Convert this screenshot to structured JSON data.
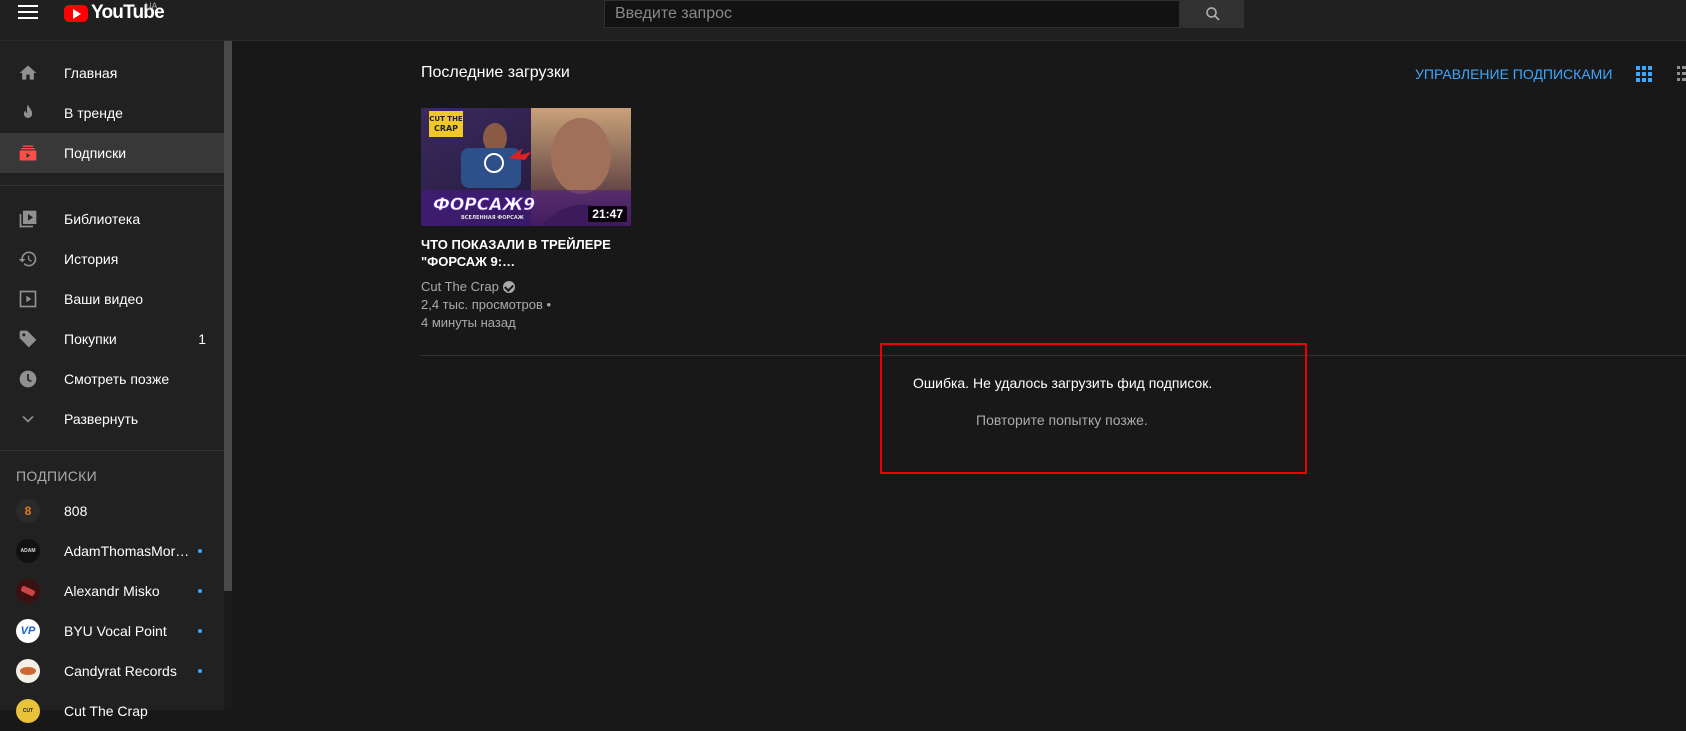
{
  "header": {
    "logo_text": "YouTube",
    "logo_region": "UA",
    "search_placeholder": "Введите запрос"
  },
  "sidebar": {
    "main_items": [
      {
        "label": "Главная",
        "icon": "home-icon"
      },
      {
        "label": "В тренде",
        "icon": "fire-icon"
      },
      {
        "label": "Подписки",
        "icon": "subscriptions-icon",
        "active": true
      }
    ],
    "library_items": [
      {
        "label": "Библиотека",
        "icon": "library-icon"
      },
      {
        "label": "История",
        "icon": "history-icon"
      },
      {
        "label": "Ваши видео",
        "icon": "your-videos-icon"
      },
      {
        "label": "Покупки",
        "icon": "tag-icon",
        "count": "1"
      },
      {
        "label": "Смотреть позже",
        "icon": "clock-icon"
      },
      {
        "label": "Развернуть",
        "icon": "chevron-down-icon"
      }
    ],
    "subscriptions_header": "ПОДПИСКИ",
    "subscriptions": [
      {
        "name": "808",
        "new": false
      },
      {
        "name": "AdamThomasMor…",
        "new": true
      },
      {
        "name": "Alexandr Misko",
        "new": true
      },
      {
        "name": "BYU Vocal Point",
        "new": true
      },
      {
        "name": "Candyrat Records",
        "new": true
      },
      {
        "name": "Cut The Crap",
        "new": false
      }
    ]
  },
  "main": {
    "section_title": "Последние загрузки",
    "manage_label": "УПРАВЛЕНИЕ ПОДПИСКАМИ",
    "video": {
      "thumbnail_text": "ФОРСАЖ9",
      "thumbnail_subtext": "ВСЕЛЕННАЯ ФОРСАЖ",
      "thumbnail_badge": "CUT THE CRAP",
      "duration": "21:47",
      "title": "ЧТО ПОКАЗАЛИ В ТРЕЙЛЕРЕ \"ФОРСАЖ 9:…",
      "channel": "Cut The Crap",
      "views": "2,4 тыс. просмотров •",
      "age": "4 минуты назад"
    },
    "error_message": "Ошибка. Не удалось загрузить фид подписок.",
    "retry_message": "Повторите попытку позже."
  },
  "colors": {
    "accent_blue": "#3ea6ff",
    "brand_red": "#ff0000",
    "error_frame": "#e00000",
    "background": "#181818",
    "sidebar_bg": "#212121"
  }
}
